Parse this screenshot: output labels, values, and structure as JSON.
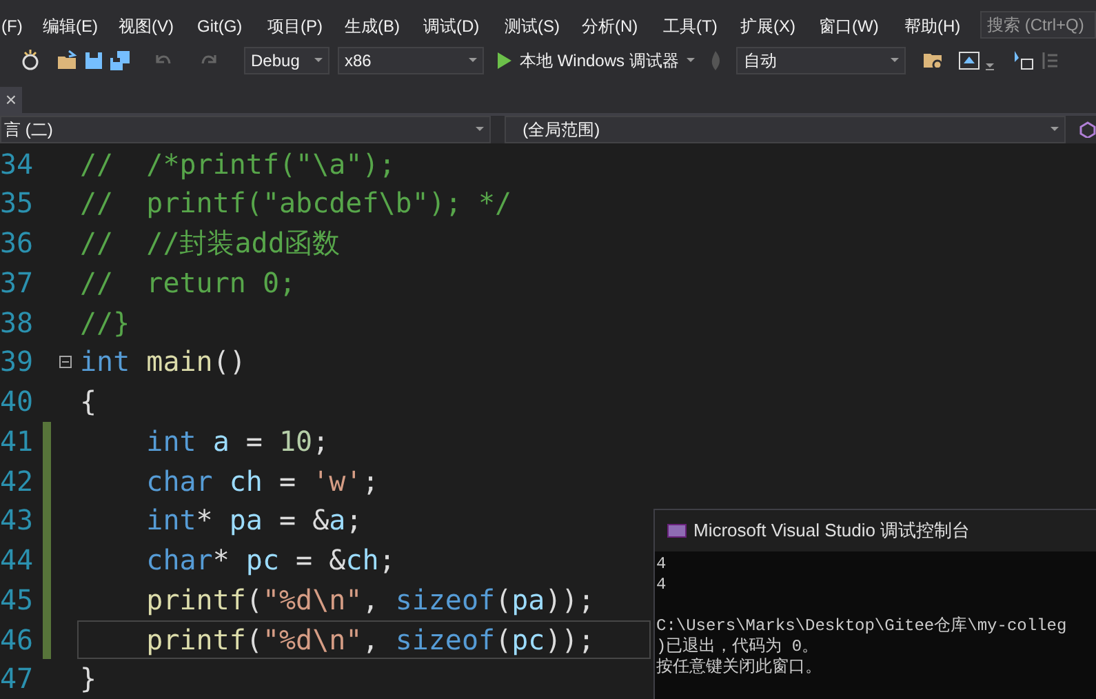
{
  "menu": [
    "(F)",
    "编辑(E)",
    "视图(V)",
    "Git(G)",
    "项目(P)",
    "生成(B)",
    "调试(D)",
    "测试(S)",
    "分析(N)",
    "工具(T)",
    "扩展(X)",
    "窗口(W)",
    "帮助(H)"
  ],
  "search": {
    "placeholder": "搜索 (Ctrl+Q)"
  },
  "toolbar": {
    "configuration": "Debug",
    "platform": "x86",
    "run_label": "本地 Windows 调试器",
    "target": "自动"
  },
  "tab_close": "×",
  "nav_bar": {
    "project": "言 (二)",
    "scope": "(全局范围)"
  },
  "code_lines": [
    {
      "number": "34",
      "changed": false,
      "current": false,
      "foldable": false,
      "tokens": [
        {
          "kind": "comment",
          "text": "//  /*printf(\"\\a\");"
        }
      ]
    },
    {
      "number": "35",
      "changed": false,
      "current": false,
      "foldable": false,
      "tokens": [
        {
          "kind": "comment",
          "text": "//  printf(\"abcdef\\b\"); */"
        }
      ]
    },
    {
      "number": "36",
      "changed": false,
      "current": false,
      "foldable": false,
      "tokens": [
        {
          "kind": "comment",
          "text": "//  //封装add函数"
        }
      ]
    },
    {
      "number": "37",
      "changed": false,
      "current": false,
      "foldable": false,
      "tokens": [
        {
          "kind": "comment",
          "text": "//  return 0;"
        }
      ]
    },
    {
      "number": "38",
      "changed": false,
      "current": false,
      "foldable": false,
      "tokens": [
        {
          "kind": "comment",
          "text": "//}"
        }
      ]
    },
    {
      "number": "39",
      "changed": false,
      "current": false,
      "foldable": true,
      "tokens": [
        {
          "kind": "keyword",
          "text": "int"
        },
        {
          "kind": "function",
          "text": " main"
        },
        {
          "kind": "plain",
          "text": "()"
        }
      ]
    },
    {
      "number": "40",
      "changed": false,
      "current": false,
      "foldable": false,
      "tokens": [
        {
          "kind": "plain",
          "text": "{"
        }
      ]
    },
    {
      "number": "41",
      "changed": true,
      "current": false,
      "foldable": false,
      "tokens": [
        {
          "kind": "keyword",
          "text": "    int"
        },
        {
          "kind": "variable",
          "text": " a"
        },
        {
          "kind": "plain",
          "text": " = "
        },
        {
          "kind": "number",
          "text": "10"
        },
        {
          "kind": "plain",
          "text": ";"
        }
      ]
    },
    {
      "number": "42",
      "changed": true,
      "current": false,
      "foldable": false,
      "tokens": [
        {
          "kind": "keyword",
          "text": "    char"
        },
        {
          "kind": "variable",
          "text": " ch"
        },
        {
          "kind": "plain",
          "text": " = "
        },
        {
          "kind": "string",
          "text": "'w'"
        },
        {
          "kind": "plain",
          "text": ";"
        }
      ]
    },
    {
      "number": "43",
      "changed": true,
      "current": false,
      "foldable": false,
      "tokens": [
        {
          "kind": "keyword",
          "text": "    int"
        },
        {
          "kind": "plain",
          "text": "* "
        },
        {
          "kind": "variable",
          "text": "pa"
        },
        {
          "kind": "plain",
          "text": " = &"
        },
        {
          "kind": "variable",
          "text": "a"
        },
        {
          "kind": "plain",
          "text": ";"
        }
      ]
    },
    {
      "number": "44",
      "changed": true,
      "current": false,
      "foldable": false,
      "tokens": [
        {
          "kind": "keyword",
          "text": "    char"
        },
        {
          "kind": "plain",
          "text": "* "
        },
        {
          "kind": "variable",
          "text": "pc"
        },
        {
          "kind": "plain",
          "text": " = &"
        },
        {
          "kind": "variable",
          "text": "ch"
        },
        {
          "kind": "plain",
          "text": ";"
        }
      ]
    },
    {
      "number": "45",
      "changed": true,
      "current": false,
      "foldable": false,
      "tokens": [
        {
          "kind": "function",
          "text": "    printf"
        },
        {
          "kind": "plain",
          "text": "("
        },
        {
          "kind": "string",
          "text": "\"%d\\n\""
        },
        {
          "kind": "plain",
          "text": ", "
        },
        {
          "kind": "keyword",
          "text": "sizeof"
        },
        {
          "kind": "plain",
          "text": "("
        },
        {
          "kind": "variable",
          "text": "pa"
        },
        {
          "kind": "plain",
          "text": "));"
        }
      ]
    },
    {
      "number": "46",
      "changed": true,
      "current": true,
      "foldable": false,
      "tokens": [
        {
          "kind": "function",
          "text": "    printf"
        },
        {
          "kind": "plain",
          "text": "("
        },
        {
          "kind": "string",
          "text": "\"%d\\n\""
        },
        {
          "kind": "plain",
          "text": ", "
        },
        {
          "kind": "keyword",
          "text": "sizeof"
        },
        {
          "kind": "plain",
          "text": "("
        },
        {
          "kind": "variable",
          "text": "pc"
        },
        {
          "kind": "plain",
          "text": "));"
        }
      ]
    },
    {
      "number": "47",
      "changed": false,
      "current": false,
      "foldable": false,
      "tokens": [
        {
          "kind": "plain",
          "text": "}"
        }
      ]
    }
  ],
  "console": {
    "title": "Microsoft Visual Studio 调试控制台",
    "output": [
      "4",
      "4"
    ],
    "messages": [
      "C:\\Users\\Marks\\Desktop\\Gitee仓库\\my-colleg",
      ")已退出，代码为 0。",
      "按任意键关闭此窗口。"
    ]
  }
}
